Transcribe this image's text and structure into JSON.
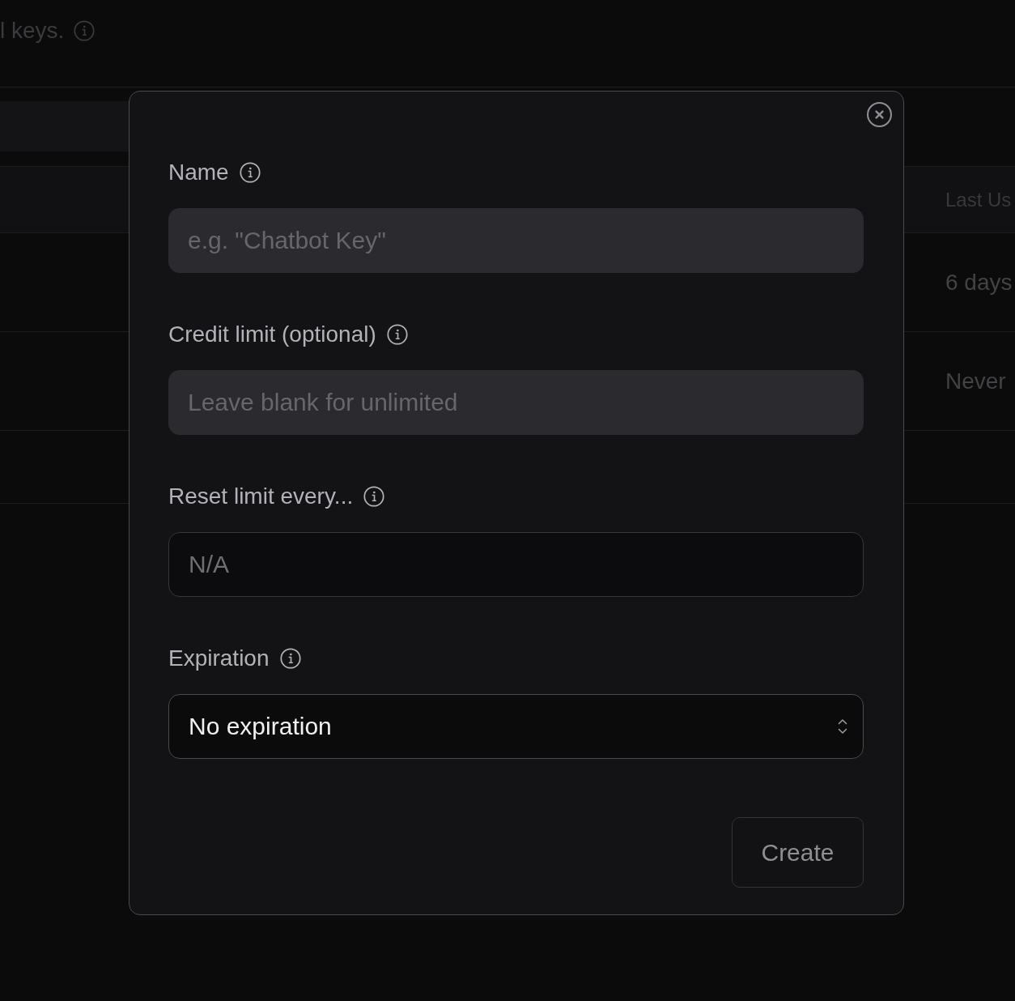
{
  "background_page": {
    "subtitle": "l keys.",
    "table": {
      "columns": [
        "Last Us"
      ],
      "rows": [
        [
          "6 days"
        ],
        [
          "Never"
        ]
      ]
    }
  },
  "dialog": {
    "fields": [
      {
        "kind": "text",
        "label": "Name",
        "placeholder": "e.g. \"Chatbot Key\"",
        "disabled": false
      },
      {
        "kind": "text",
        "label": "Credit limit (optional)",
        "placeholder": "Leave blank for unlimited",
        "disabled": false
      },
      {
        "kind": "text",
        "label": "Reset limit every...",
        "placeholder": "N/A",
        "disabled": true
      },
      {
        "kind": "select",
        "label": "Expiration",
        "value": "No expiration",
        "disabled": false
      }
    ],
    "submit": {
      "label": "Create",
      "disabled": true
    }
  }
}
